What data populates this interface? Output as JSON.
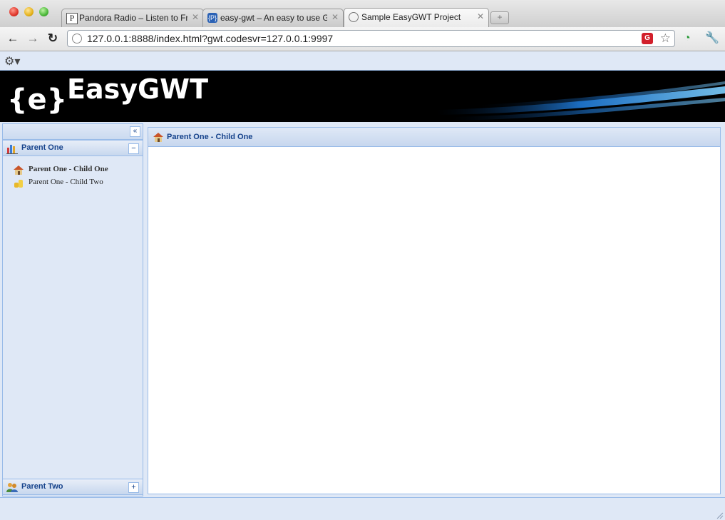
{
  "browser": {
    "tabs": [
      {
        "label": "Pandora Radio – Listen to Fre",
        "icon": "pandora-icon"
      },
      {
        "label": "easy-gwt – An easy to use G",
        "icon": "google-code-icon"
      },
      {
        "label": "Sample EasyGWT Project",
        "icon": "globe-icon"
      }
    ],
    "new_tab": "+",
    "url": "127.0.0.1:8888/index.html?gwt.codesvr=127.0.0.1:9997"
  },
  "app": {
    "menu_icon": "gear-icon",
    "logo": {
      "brace": "{e}",
      "word": "EasyGWT"
    },
    "west": {
      "collapse_symbol": "«",
      "groups": [
        {
          "label": "Parent One",
          "tool": "−",
          "icon": "chart-icon",
          "items": [
            {
              "label": "Parent One - Child One",
              "icon": "house-icon",
              "selected": true
            },
            {
              "label": "Parent One - Child Two",
              "icon": "coins-icon",
              "selected": false
            }
          ]
        },
        {
          "label": "Parent Two",
          "tool": "+",
          "icon": "users-icon",
          "items": []
        }
      ]
    },
    "center": {
      "title": "Parent One - Child One",
      "icon": "house-icon"
    }
  }
}
